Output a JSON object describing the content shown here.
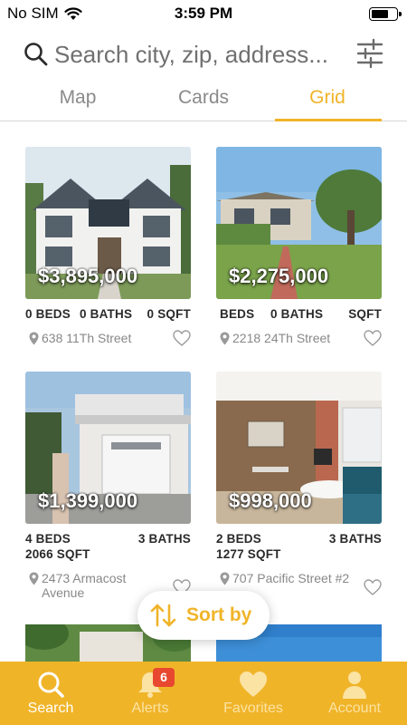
{
  "status_bar": {
    "carrier": "No SIM",
    "time": "3:59 PM",
    "battery_level": 0.7
  },
  "search": {
    "placeholder": "Search city, zip, address..."
  },
  "tabs": [
    {
      "label": "Map",
      "active": false
    },
    {
      "label": "Cards",
      "active": false
    },
    {
      "label": "Grid",
      "active": true
    }
  ],
  "listings": [
    {
      "price": "$3,895,000",
      "beds": "0 BEDS",
      "baths": "0 BATHS",
      "sqft": "0 SQFT",
      "address": "638 11Th Street",
      "favorite": false
    },
    {
      "price": "$2,275,000",
      "beds": "BEDS",
      "baths": "0 BATHS",
      "sqft": "SQFT",
      "address": "2218 24Th Street",
      "favorite": false
    },
    {
      "price": "$1,399,000",
      "beds": "4 BEDS",
      "baths": "3 BATHS",
      "sqft": "2066 SQFT",
      "address": "2473 Armacost Avenue",
      "favorite": false
    },
    {
      "price": "$998,000",
      "beds": "2 BEDS",
      "baths": "3 BATHS",
      "sqft": "1277 SQFT",
      "address": "707 Pacific Street #2",
      "favorite": false
    }
  ],
  "sort": {
    "label": "Sort by"
  },
  "bottom_nav": [
    {
      "label": "Search",
      "icon": "search-icon",
      "active": true
    },
    {
      "label": "Alerts",
      "icon": "bell-icon",
      "active": false,
      "badge": "6"
    },
    {
      "label": "Favorites",
      "icon": "heart-icon",
      "active": false
    },
    {
      "label": "Account",
      "icon": "person-icon",
      "active": false
    }
  ],
  "colors": {
    "accent": "#f0b429",
    "badge": "#e8482f",
    "text_dark": "#2a2a2a",
    "text_muted": "#888888"
  }
}
